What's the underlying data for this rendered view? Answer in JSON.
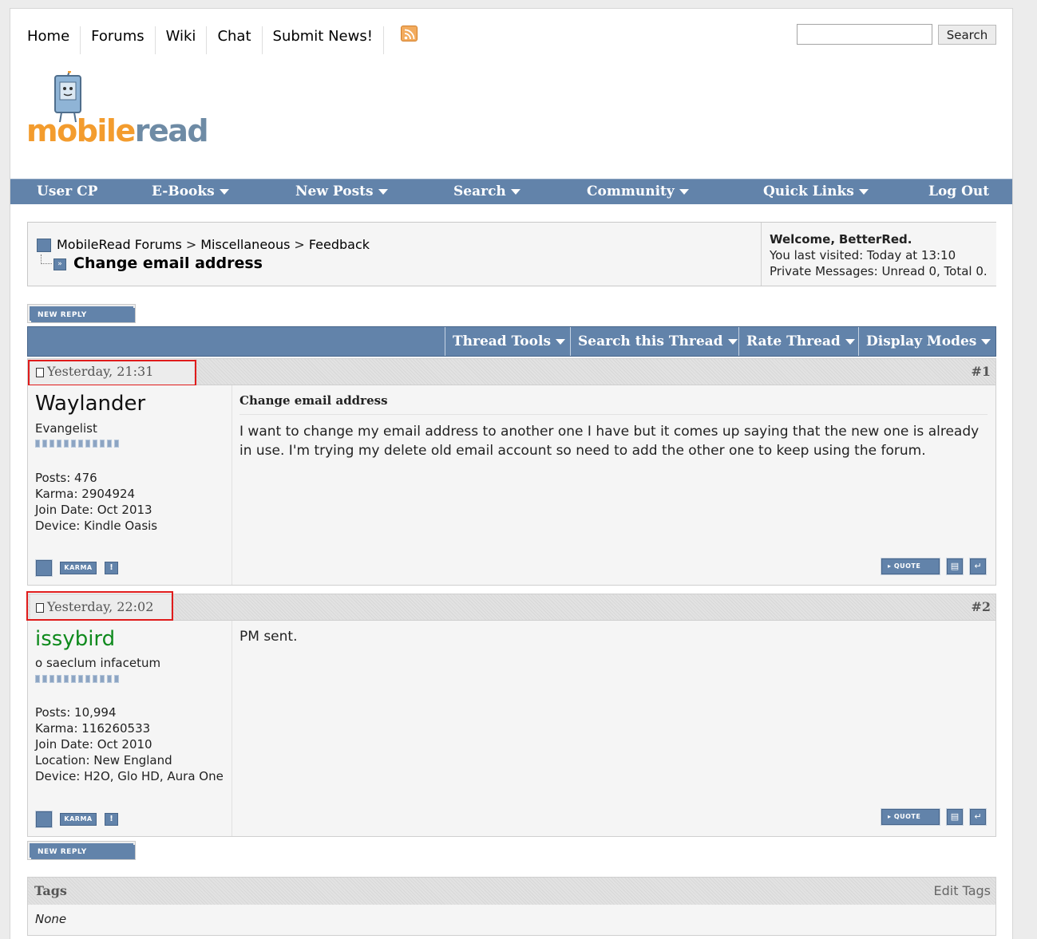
{
  "topnav": {
    "items": [
      "Home",
      "Forums",
      "Wiki",
      "Chat",
      "Submit News!"
    ],
    "search_placeholder": "",
    "search_button": "Search"
  },
  "logo": {
    "part1": "mobile",
    "part2": "read"
  },
  "menu": {
    "items": [
      "User CP",
      "E-Books",
      "New Posts",
      "Search",
      "Community",
      "Quick Links",
      "Log Out"
    ]
  },
  "breadcrumb": {
    "items": [
      "MobileRead Forums",
      "Miscellaneous",
      "Feedback"
    ],
    "separator": ">",
    "current": "Change email address"
  },
  "welcome": {
    "greeting": "Welcome,",
    "user": "BetterRed.",
    "last_visited": "You last visited: Today at 13:10",
    "pm": "Private Messages: Unread 0, Total 0."
  },
  "buttons": {
    "new_reply": "NEW REPLY",
    "quote": "QUOTE",
    "karma": "KARMA"
  },
  "toolbar": {
    "items": [
      "Thread Tools",
      "Search this Thread",
      "Rate Thread",
      "Display Modes"
    ]
  },
  "posts": [
    {
      "date": "Yesterday, 21:31",
      "number": "#1",
      "username": "Waylander",
      "user_title": "Evangelist",
      "stats": [
        "Posts: 476",
        "Karma: 2904924",
        "Join Date: Oct 2013",
        "Device: Kindle Oasis"
      ],
      "title": "Change email address",
      "message": "I want to change my email address to another one I have but it comes up saying that the new one is already in use. I'm trying my delete old email account so need to add the other one to keep using the forum."
    },
    {
      "date": "Yesterday, 22:02",
      "number": "#2",
      "username": "issybird",
      "user_title": "o saeclum infacetum",
      "stats": [
        "Posts: 10,994",
        "Karma: 116260533",
        "Join Date: Oct 2010",
        "Location: New England",
        "Device: H2O, Glo HD, Aura One"
      ],
      "message": "PM sent."
    }
  ],
  "tags": {
    "title": "Tags",
    "edit": "Edit Tags",
    "value": "None"
  },
  "colors": {
    "menu_blue": "#6283aa",
    "highlight_red": "#e01b1b",
    "username_green": "#0f8a1d",
    "logo_orange": "#f39c2e"
  }
}
